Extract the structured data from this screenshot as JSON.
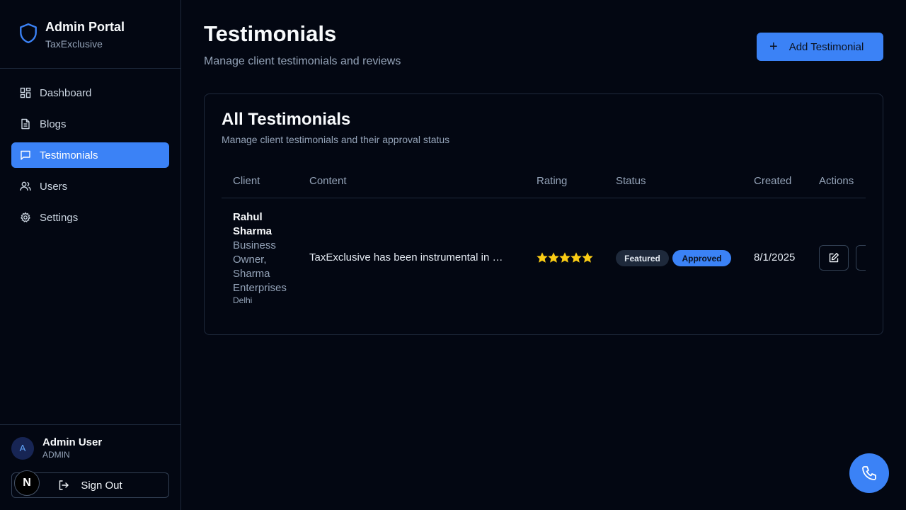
{
  "brand": {
    "title": "Admin Portal",
    "subtitle": "TaxExclusive",
    "icon": "shield-icon"
  },
  "sidebar": {
    "items": [
      {
        "label": "Dashboard",
        "icon": "dashboard-icon",
        "active": false
      },
      {
        "label": "Blogs",
        "icon": "document-icon",
        "active": false
      },
      {
        "label": "Testimonials",
        "icon": "message-square-icon",
        "active": true
      },
      {
        "label": "Users",
        "icon": "users-icon",
        "active": false
      },
      {
        "label": "Settings",
        "icon": "gear-icon",
        "active": false
      }
    ]
  },
  "user": {
    "avatar_initial": "A",
    "name": "Admin User",
    "role": "ADMIN"
  },
  "signout_label": "Sign Out",
  "floating_badge": "N",
  "header": {
    "title": "Testimonials",
    "subtitle": "Manage client testimonials and reviews",
    "add_button": "Add Testimonial"
  },
  "card": {
    "title": "All Testimonials",
    "subtitle": "Manage client testimonials and their approval status",
    "columns": [
      "Client",
      "Content",
      "Rating",
      "Status",
      "Created",
      "Actions"
    ],
    "rows": [
      {
        "client_name": "Rahul Sharma",
        "client_role": "Business Owner, Sharma Enterprises",
        "client_location": "Delhi",
        "content": "TaxExclusive has been instrumental in …",
        "rating": 5,
        "status_featured": "Featured",
        "status_approval": "Approved",
        "created": "8/1/2025"
      }
    ]
  },
  "colors": {
    "accent": "#3b82f6",
    "background": "#030712",
    "star": "#facc15"
  }
}
